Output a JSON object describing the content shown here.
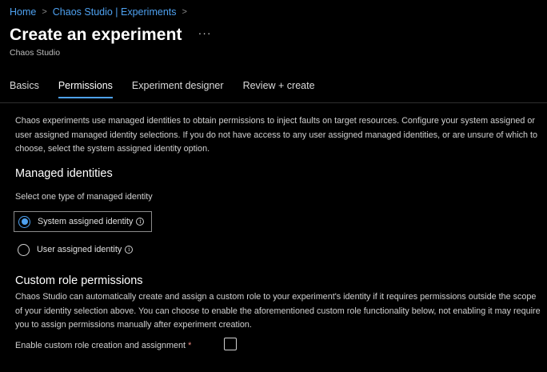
{
  "breadcrumb": {
    "items": [
      "Home",
      "Chaos Studio | Experiments"
    ],
    "separator": ">"
  },
  "header": {
    "title": "Create an experiment",
    "more_label": "···",
    "subtitle": "Chaos Studio"
  },
  "tabs": [
    {
      "label": "Basics",
      "active": false
    },
    {
      "label": "Permissions",
      "active": true
    },
    {
      "label": "Experiment designer",
      "active": false
    },
    {
      "label": "Review + create",
      "active": false
    }
  ],
  "permissions": {
    "intro": "Chaos experiments use managed identities to obtain permissions to inject faults on target resources. Configure your system assigned or user assigned managed identity selections. If you do not have access to any user assigned managed identities, or are unsure of which to choose, select the system assigned identity option.",
    "managed_identities": {
      "title": "Managed identities",
      "select_label": "Select one type of managed identity",
      "options": [
        {
          "label": "System assigned identity",
          "selected": true
        },
        {
          "label": "User assigned identity",
          "selected": false
        }
      ],
      "info_glyph": "i"
    },
    "custom_role": {
      "title": "Custom role permissions",
      "description": "Chaos Studio can automatically create and assign a custom role to your experiment's identity if it requires permissions outside the scope of your identity selection above. You can choose to enable the aforementioned custom role functionality below, not enabling it may require you to assign permissions manually after experiment creation.",
      "checkbox_label": "Enable custom role creation and assignment",
      "required_mark": "*",
      "checked": false
    }
  },
  "colors": {
    "background": "#000000",
    "accent": "#4ea1f0",
    "required": "#f28b82"
  }
}
